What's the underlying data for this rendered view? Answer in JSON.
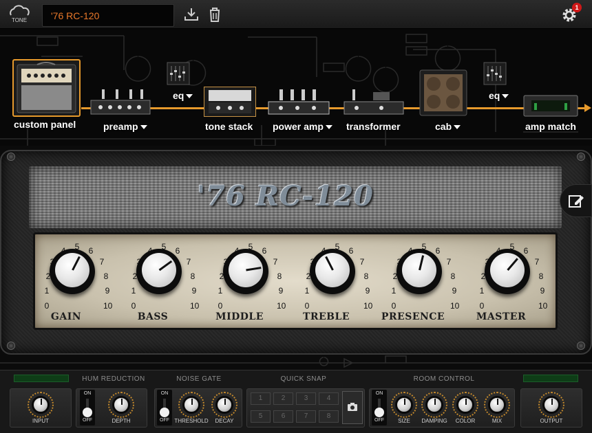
{
  "app": {
    "logo_text": "TONE",
    "preset_name": "'76 RC-120",
    "notification_count": "1"
  },
  "chain": {
    "modules": [
      {
        "id": "custom-panel",
        "label": "custom panel",
        "dropdown": false,
        "selected": true
      },
      {
        "id": "preamp",
        "label": "preamp",
        "dropdown": true
      },
      {
        "id": "eq1",
        "label": "eq",
        "dropdown": true
      },
      {
        "id": "tone-stack",
        "label": "tone stack",
        "dropdown": false
      },
      {
        "id": "power-amp",
        "label": "power amp",
        "dropdown": true
      },
      {
        "id": "transformer",
        "label": "transformer",
        "dropdown": false
      },
      {
        "id": "cab",
        "label": "cab",
        "dropdown": true
      },
      {
        "id": "eq2",
        "label": "eq",
        "dropdown": true
      },
      {
        "id": "amp-match",
        "label": "amp match",
        "dropdown": false
      }
    ],
    "accent_color": "#e79a2c"
  },
  "amp": {
    "model_name": "'76 RC-120",
    "scale": [
      "0",
      "1",
      "2",
      "3",
      "4",
      "5",
      "6",
      "7",
      "8",
      "9",
      "10"
    ],
    "knobs": [
      {
        "label": "GAIN",
        "value": 6
      },
      {
        "label": "BASS",
        "value": 7
      },
      {
        "label": "MIDDLE",
        "value": 8
      },
      {
        "label": "TREBLE",
        "value": 4
      },
      {
        "label": "PRESENCE",
        "value": 5.5
      },
      {
        "label": "MASTER",
        "value": 6.5
      }
    ]
  },
  "bottom": {
    "sections": {
      "hum_reduction": "HUM REDUCTION",
      "noise_gate": "NOISE GATE",
      "quick_snap": "QUICK SNAP",
      "room_control": "ROOM CONTROL"
    },
    "knobs": {
      "input": "INPUT",
      "depth": "DEPTH",
      "threshold": "THRESHOLD",
      "decay": "DECAY",
      "size": "SIZE",
      "damping": "DAMPING",
      "color": "COLOR",
      "mix": "MIX",
      "output": "OUTPUT"
    },
    "toggle": {
      "on": "ON",
      "off": "OFF"
    },
    "snaps": [
      "1",
      "2",
      "3",
      "4",
      "5",
      "6",
      "7",
      "8"
    ]
  }
}
